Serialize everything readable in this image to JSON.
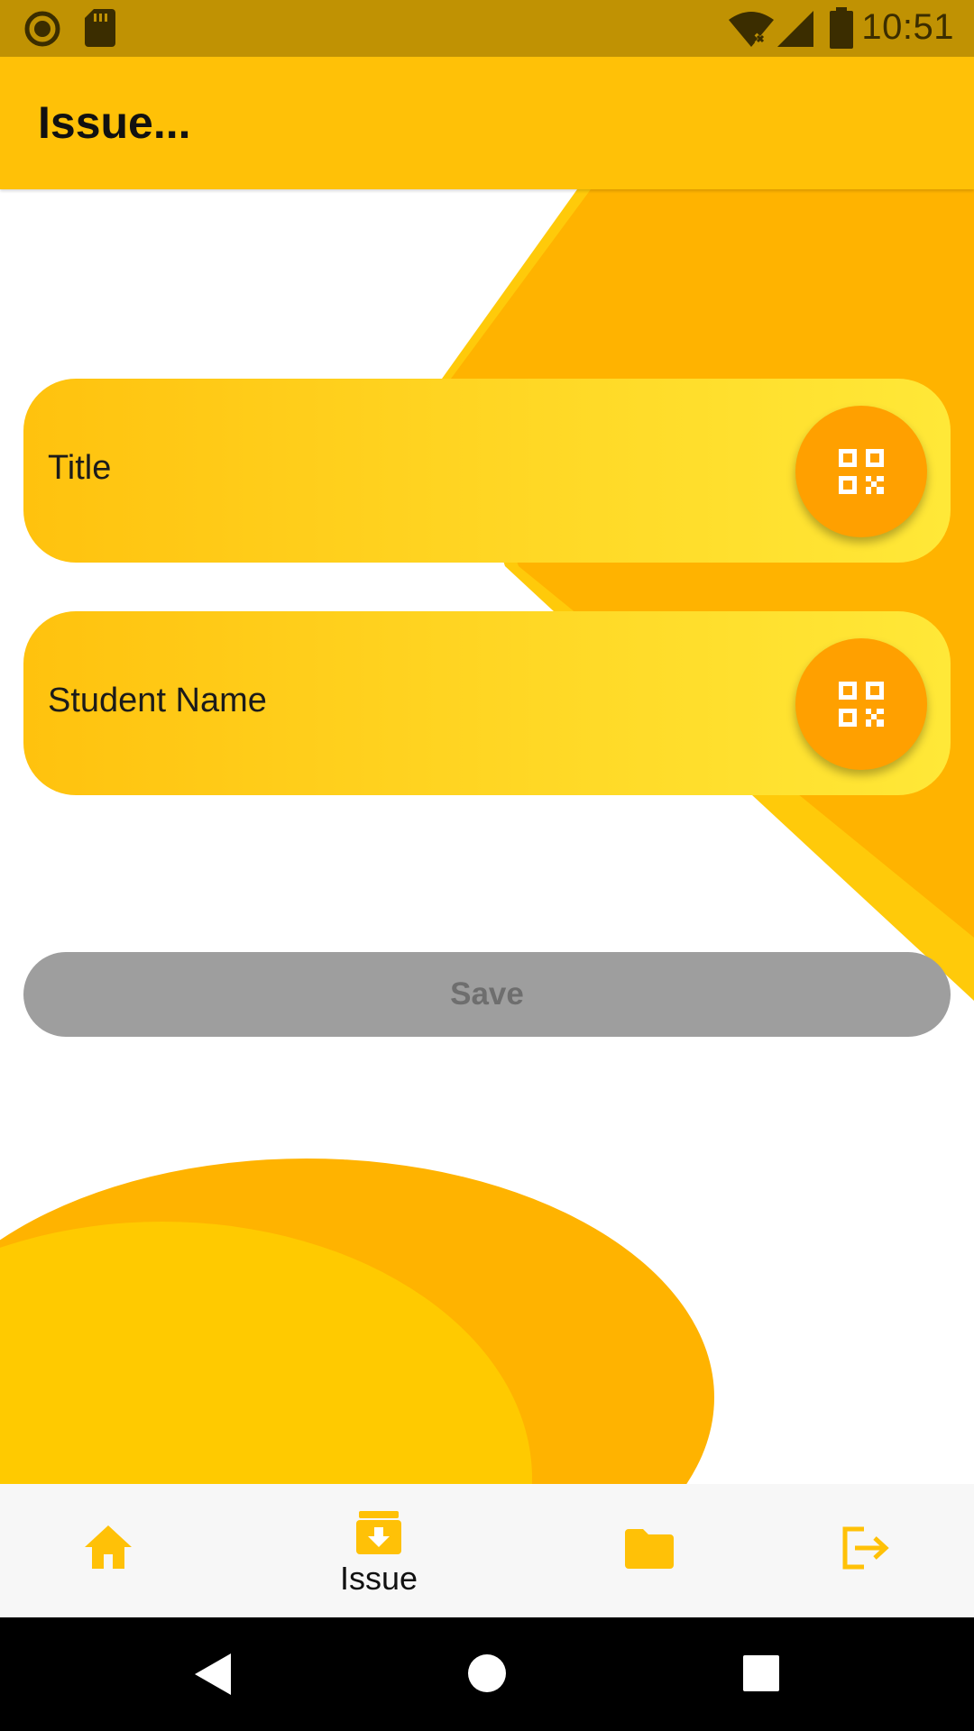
{
  "status_bar": {
    "time": "10:51",
    "left_icons": [
      "record-icon",
      "sd-card-icon"
    ],
    "right_icons": [
      "wifi-off-icon",
      "signal-icon",
      "battery-icon"
    ]
  },
  "app_bar": {
    "title": "Issue..."
  },
  "form": {
    "fields": [
      {
        "label": "Title",
        "action_icon": "qr-code-icon"
      },
      {
        "label": "Student Name",
        "action_icon": "qr-code-icon"
      }
    ],
    "save_label": "Save"
  },
  "bottom_nav": {
    "items": [
      {
        "icon": "home-icon",
        "label": ""
      },
      {
        "icon": "archive-download-icon",
        "label": "Issue",
        "selected": true
      },
      {
        "icon": "folder-icon",
        "label": ""
      },
      {
        "icon": "logout-icon",
        "label": ""
      }
    ]
  },
  "colors": {
    "status_bar": "#c09203",
    "app_bar": "#ffc107",
    "accent": "#ffa000",
    "card_start": "#ffc20e",
    "card_end": "#ffe838",
    "save_disabled": "#9e9e9e",
    "nav_icon": "#ffc107"
  }
}
